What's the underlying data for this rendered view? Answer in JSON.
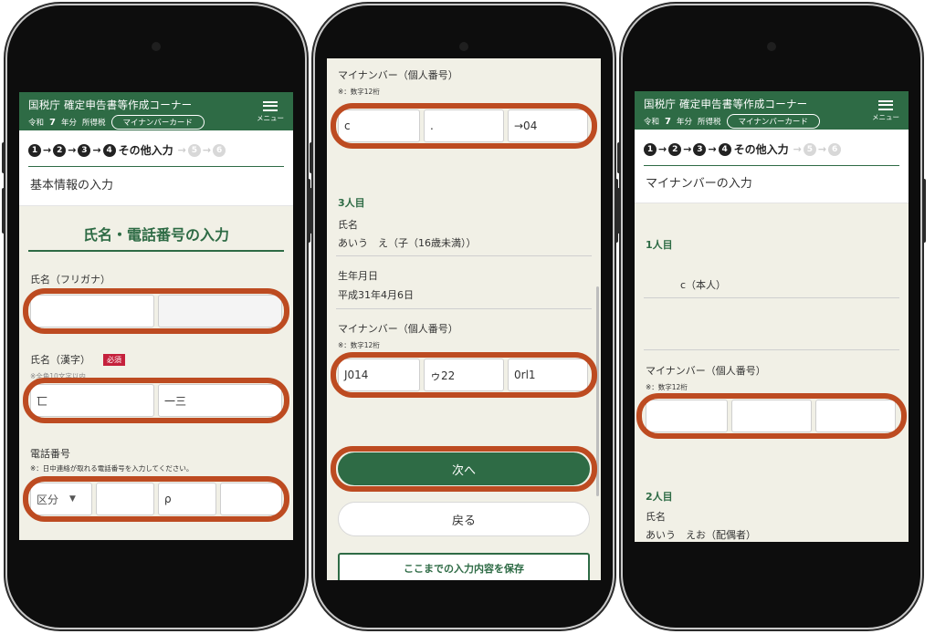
{
  "header": {
    "title": "国税庁 確定申告書等作成コーナー",
    "era": "令和",
    "year": "7",
    "year_unit": "年分",
    "tax": "所得税",
    "mynumber_card": "マイナンバーカード",
    "menu": "メニュー"
  },
  "steps": {
    "numbers": [
      "1",
      "2",
      "3",
      "4",
      "5",
      "6"
    ],
    "current_label": "その他入力"
  },
  "screen1": {
    "section": "基本情報の入力",
    "title": "氏名・電話番号の入力",
    "kana_label": "氏名（フリガナ）",
    "kanji_label": "氏名（漢字）",
    "required": "必須",
    "kanji_note": "※全角10文字以内",
    "kanji_values": [
      "匸",
      "一三"
    ],
    "phone_label": "電話番号",
    "phone_note": "※：日中連絡が取れる電話番号を入力してください。",
    "phone_select": "区分",
    "phone_values": [
      "",
      "ρ",
      ""
    ]
  },
  "screen2": {
    "mynumber_label": "マイナンバー（個人番号）",
    "mynumber_note": "※：数字12桁",
    "top_values": [
      "c",
      ".",
      "→04"
    ],
    "person3_head": "3人目",
    "name_label": "氏名",
    "name_value": "あいう　え（子（16歳未満））",
    "birth_label": "生年月日",
    "birth_value": "平成31年4月6日",
    "mynumber3_label": "マイナンバー（個人番号）",
    "mynumber3_note": "※：数字12桁",
    "mynumber3_values": [
      "J014",
      "ゥ22",
      "0rl1"
    ],
    "next_button": "次へ",
    "back_button": "戻る",
    "save_button": "ここまでの入力内容を保存"
  },
  "screen3": {
    "section": "マイナンバーの入力",
    "person1_head": "1人目",
    "person1_name": "c（本人）",
    "mynumber_label": "マイナンバー（個人番号）",
    "mynumber_note": "※：数字12桁",
    "person2_head": "2人目",
    "name_label": "氏名",
    "person2_name": "あいう　えお（配偶者）"
  },
  "colors": {
    "header_green": "#2e6b45",
    "highlight_orange": "#bd4b21",
    "required_red": "#c5213c"
  }
}
